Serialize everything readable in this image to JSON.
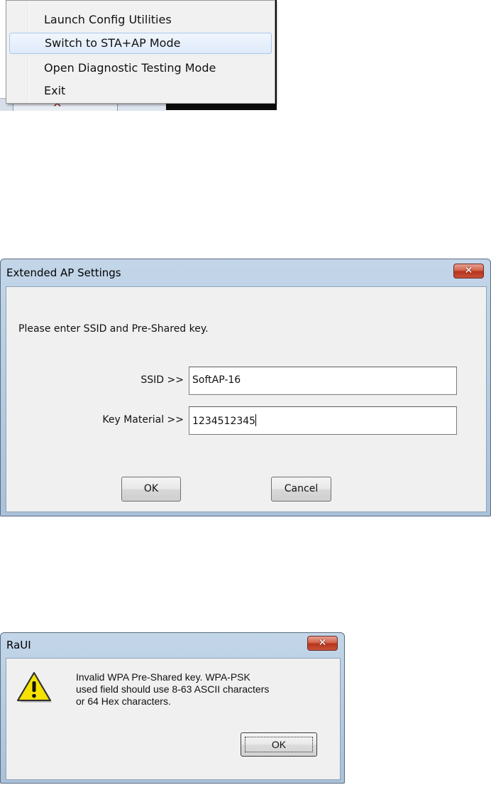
{
  "context_menu": {
    "items": [
      {
        "label": "Launch Config Utilities"
      },
      {
        "label": "Switch to STA+AP Mode",
        "highlighted": true
      },
      {
        "label": "Open Diagnostic Testing Mode"
      },
      {
        "label": "Exit"
      }
    ]
  },
  "ap_dialog": {
    "title": "Extended AP Settings",
    "close_label": "✕",
    "prompt": "Please enter SSID and Pre-Shared key.",
    "ssid_label": "SSID >>",
    "ssid_value": "SoftAP-16",
    "key_label": "Key Material >>",
    "key_value": "1234512345",
    "ok_label": "OK",
    "cancel_label": "Cancel"
  },
  "raui_dialog": {
    "title": "RaUI",
    "close_label": "✕",
    "icon": "warning-icon",
    "message_lines": [
      "Invalid WPA Pre-Shared key. WPA-PSK",
      "used field should use 8-63 ASCII characters",
      "or 64 Hex characters."
    ],
    "ok_label": "OK"
  },
  "colors": {
    "menu_highlight": "#dfeafa",
    "close_button": "#c9513a",
    "dialog_frame": "#a9c1d9",
    "warning_yellow": "#f6e200"
  }
}
